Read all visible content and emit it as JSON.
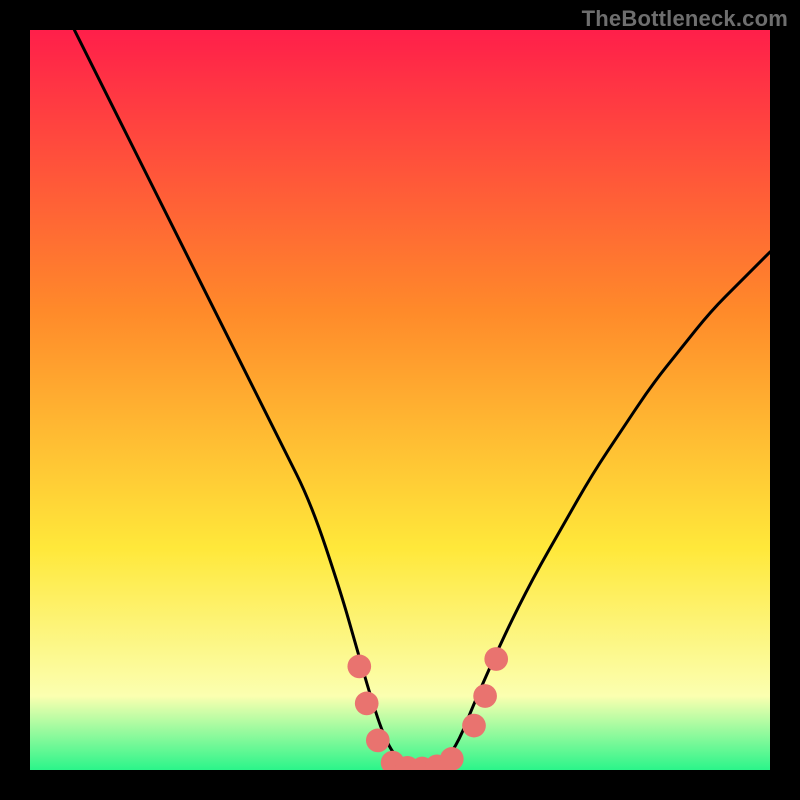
{
  "watermark": "TheBottleneck.com",
  "colors": {
    "gradient_top": "#ff1f4a",
    "gradient_mid1": "#ff8a2a",
    "gradient_mid2": "#ffe83a",
    "gradient_low": "#fbffb0",
    "gradient_bottom": "#2bf58a",
    "curve": "#000000",
    "marker": "#e9736f",
    "frame": "#000000"
  },
  "chart_data": {
    "type": "line",
    "title": "",
    "xlabel": "",
    "ylabel": "",
    "xlim": [
      0,
      100
    ],
    "ylim": [
      0,
      100
    ],
    "series": [
      {
        "name": "bottleneck-curve",
        "x": [
          6,
          10,
          14,
          18,
          22,
          26,
          30,
          34,
          38,
          42,
          44,
          46,
          48,
          50,
          52,
          54,
          56,
          58,
          60,
          64,
          68,
          72,
          76,
          80,
          84,
          88,
          92,
          96,
          100
        ],
        "y": [
          100,
          92,
          84,
          76,
          68,
          60,
          52,
          44,
          36,
          24,
          17,
          10,
          4,
          1,
          0,
          0,
          1,
          4,
          9,
          18,
          26,
          33,
          40,
          46,
          52,
          57,
          62,
          66,
          70
        ]
      }
    ],
    "markers": [
      {
        "x": 44.5,
        "y": 14
      },
      {
        "x": 45.5,
        "y": 9
      },
      {
        "x": 47.0,
        "y": 4
      },
      {
        "x": 49.0,
        "y": 1
      },
      {
        "x": 51.0,
        "y": 0.3
      },
      {
        "x": 53.0,
        "y": 0.2
      },
      {
        "x": 55.0,
        "y": 0.5
      },
      {
        "x": 57.0,
        "y": 1.5
      },
      {
        "x": 60.0,
        "y": 6
      },
      {
        "x": 61.5,
        "y": 10
      },
      {
        "x": 63.0,
        "y": 15
      }
    ],
    "marker_radius_pct": 1.6
  }
}
